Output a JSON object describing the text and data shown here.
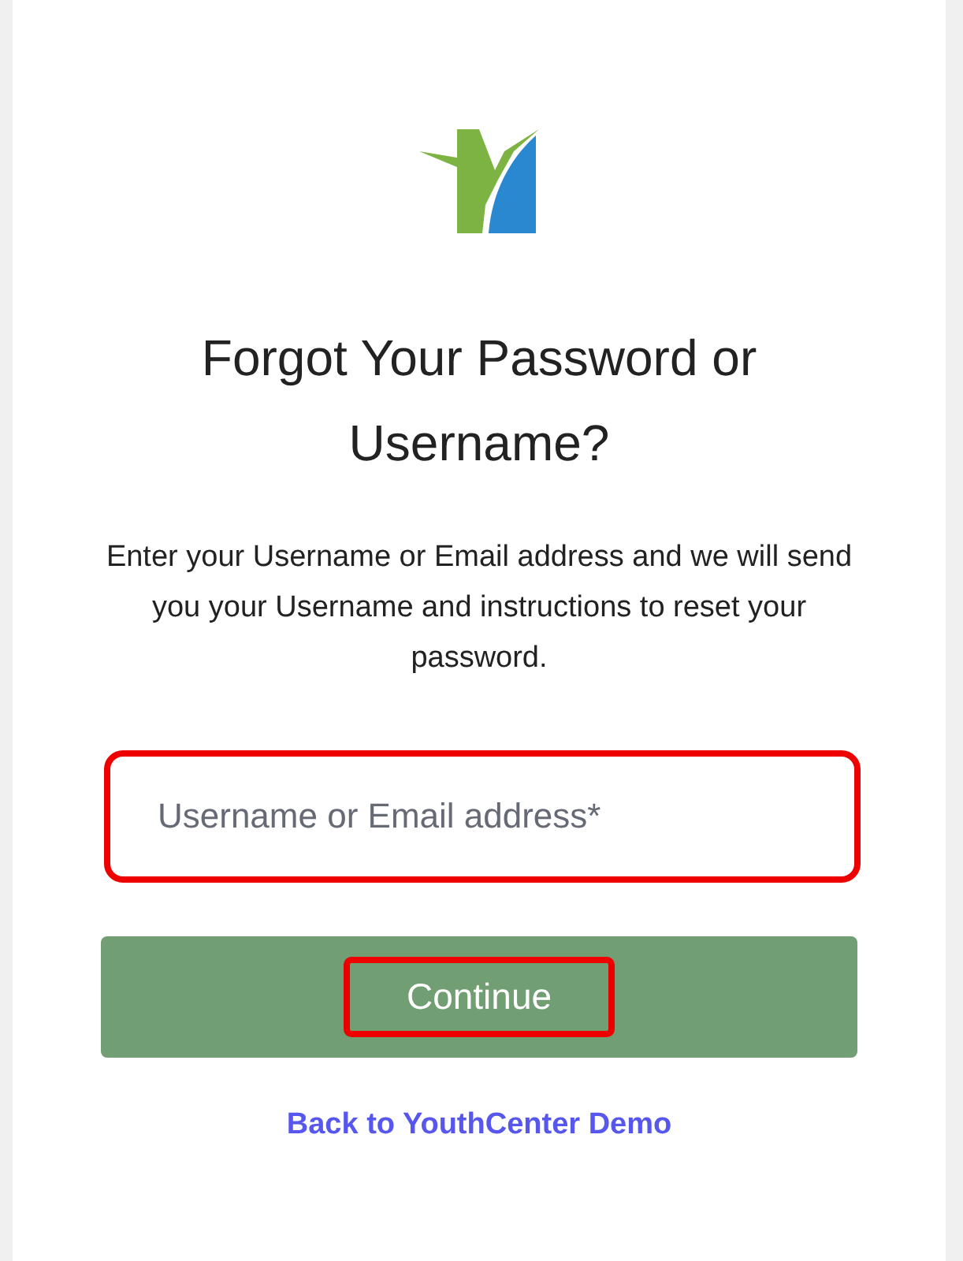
{
  "title": "Forgot Your Password or Username?",
  "instructions": "Enter your Username or Email address and we will send you your Username and instructions to reset your password.",
  "field": {
    "placeholder": "Username or Email address*",
    "highlighted": true
  },
  "button": {
    "label": "Continue",
    "highlighted": true
  },
  "link": "Back to YouthCenter Demo"
}
